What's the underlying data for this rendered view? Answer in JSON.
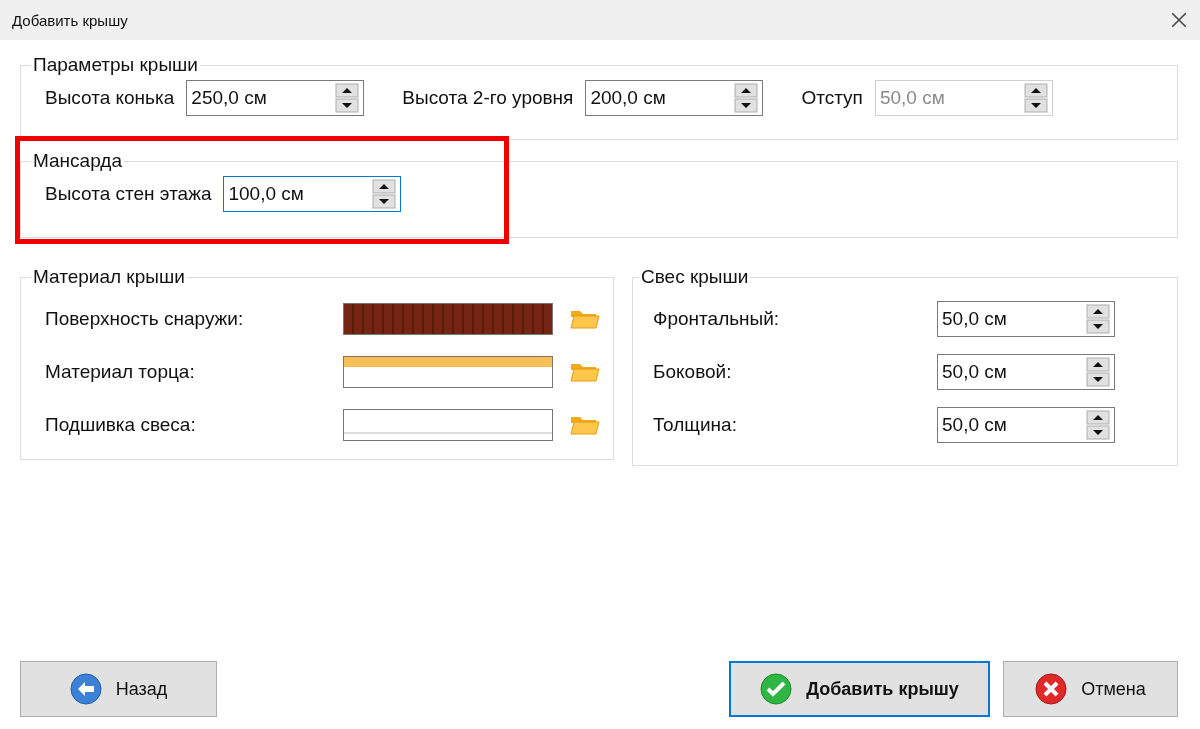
{
  "window": {
    "title": "Добавить крышу"
  },
  "roof_params": {
    "title": "Параметры крыши",
    "fields": [
      {
        "label": "Высота конька",
        "value": "250,0 см",
        "disabled": false,
        "focused": false
      },
      {
        "label": "Высота 2-го уровня",
        "value": "200,0 см",
        "disabled": false,
        "focused": false
      },
      {
        "label": "Отступ",
        "value": "50,0 см",
        "disabled": true,
        "focused": false
      }
    ]
  },
  "attic": {
    "title": "Мансарда",
    "highlighted": true,
    "fields": [
      {
        "label": "Высота стен этажа",
        "value": "100,0 см",
        "disabled": false,
        "focused": true
      }
    ]
  },
  "roof_material": {
    "title": "Материал крыши",
    "rows": [
      {
        "label": "Поверхность снаружи:",
        "kind": "tile"
      },
      {
        "label": "Материал торца:",
        "kind": "strip"
      },
      {
        "label": "Подшивка свеса:",
        "kind": "plain"
      }
    ]
  },
  "overhang": {
    "title": "Свес крыши",
    "fields": [
      {
        "label": "Фронтальный:",
        "value": "50,0 см",
        "disabled": false,
        "focused": false
      },
      {
        "label": "Боковой:",
        "value": "50,0 см",
        "disabled": false,
        "focused": false
      },
      {
        "label": "Толщина:",
        "value": "50,0 см",
        "disabled": false,
        "focused": false
      }
    ]
  },
  "buttons": [
    {
      "label": "Назад",
      "kind": "back",
      "default": false
    },
    {
      "label": "Добавить крышу",
      "kind": "ok",
      "default": true
    },
    {
      "label": "Отмена",
      "kind": "cancel",
      "default": false
    }
  ]
}
